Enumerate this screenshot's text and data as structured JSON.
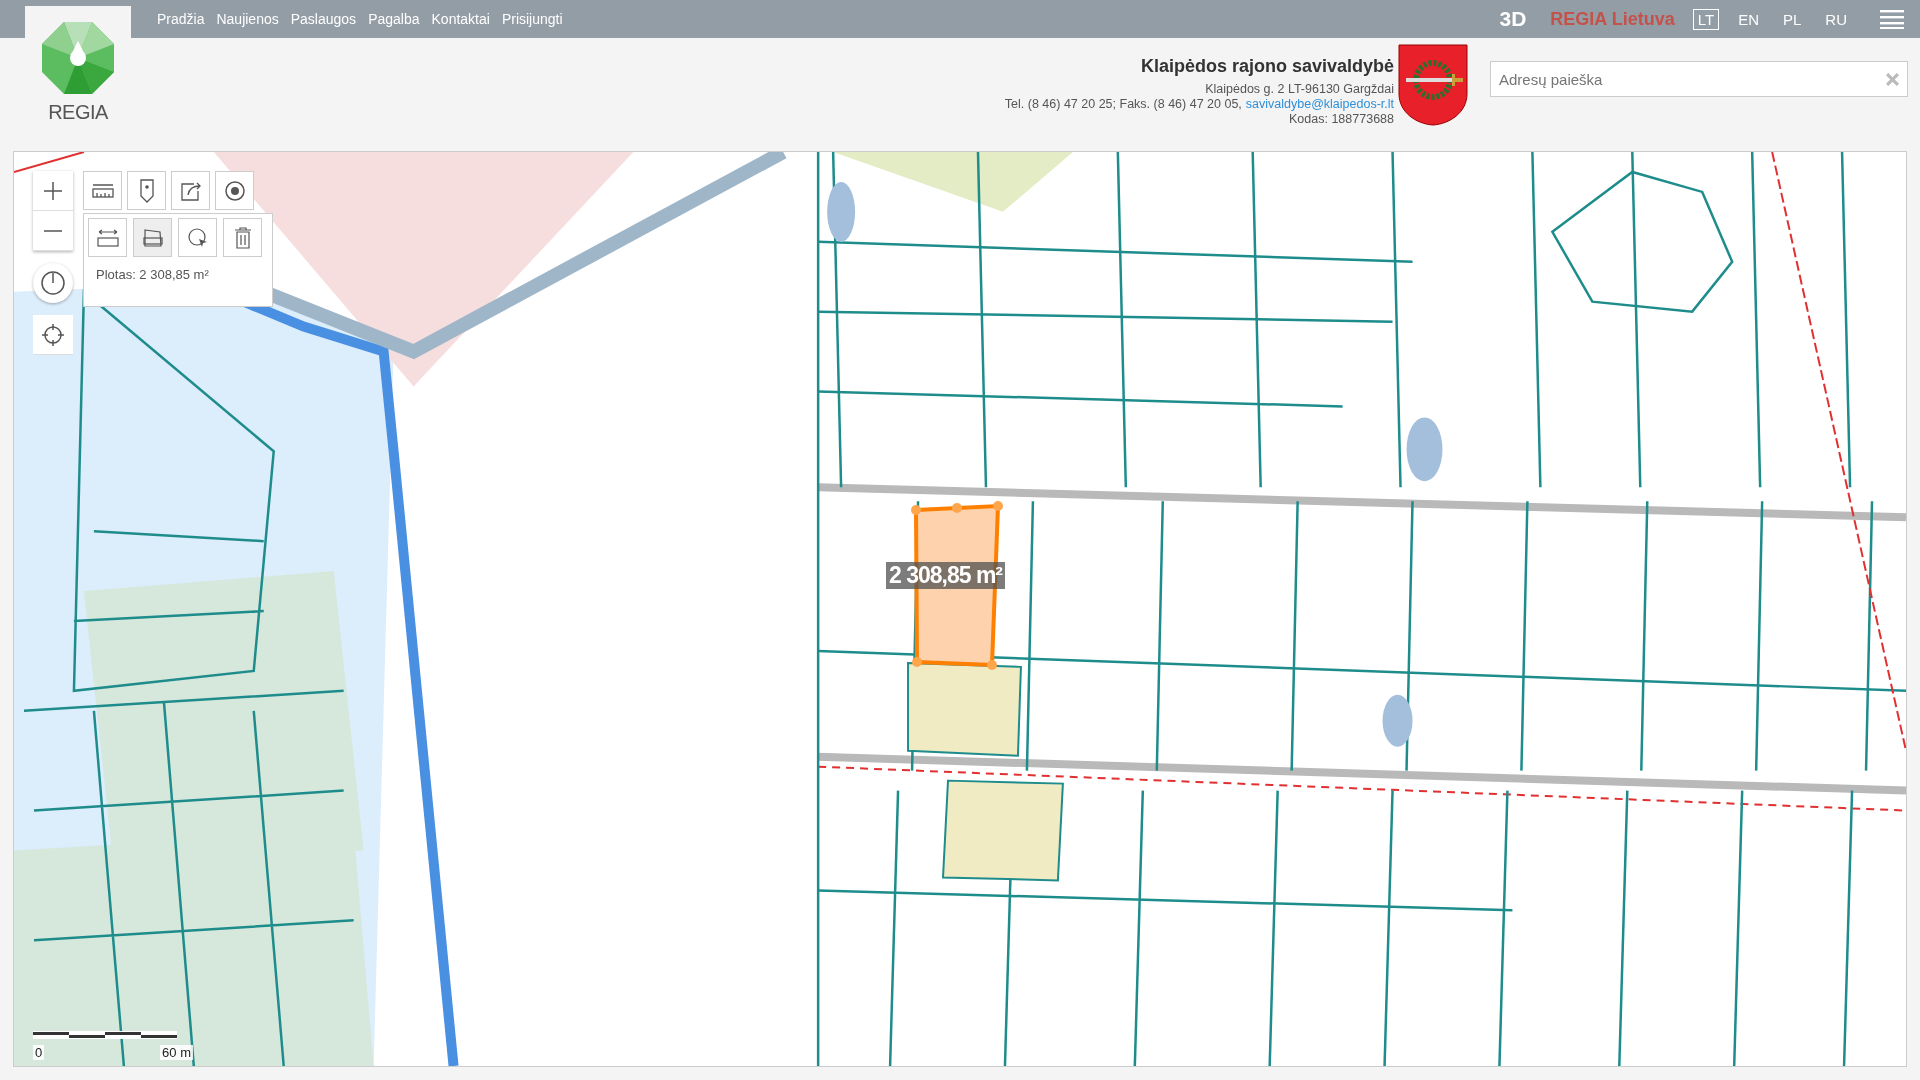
{
  "nav": {
    "links": [
      "Pradžia",
      "Naujienos",
      "Paslaugos",
      "Pagalba",
      "Kontaktai",
      "Prisijungti"
    ]
  },
  "top_right": {
    "mode": "3D",
    "brand": "REGIA Lietuva",
    "languages": [
      {
        "label": "LT",
        "selected": true
      },
      {
        "label": "EN",
        "selected": false
      },
      {
        "label": "PL",
        "selected": false
      },
      {
        "label": "RU",
        "selected": false
      }
    ]
  },
  "logo": {
    "text": "REGIA"
  },
  "municipality": {
    "name": "Klaipėdos rajono savivaldybė",
    "address": "Klaipėdos g. 2 LT-96130 Gargždai",
    "contacts": "Tel. (8 46) 47 20 25; Faks. (8 46) 47 20 05,",
    "email": "savivaldybe@klaipedos-r.lt",
    "code": "Kodas: 188773688"
  },
  "search": {
    "placeholder": "Adresų paieška"
  },
  "map": {
    "measure_tools": [
      {
        "kind": "distance",
        "selected": false
      },
      {
        "kind": "area",
        "selected": true
      },
      {
        "kind": "pick",
        "selected": false
      },
      {
        "kind": "delete",
        "selected": false
      }
    ],
    "measurement": {
      "area_label": "2 308,85 m²",
      "result": "Plotas: 2 308,85 m²"
    },
    "scale": {
      "start": "0",
      "end": "60 m"
    }
  }
}
